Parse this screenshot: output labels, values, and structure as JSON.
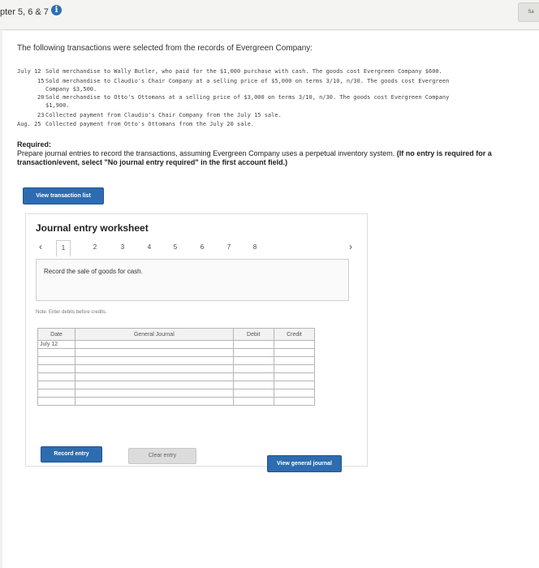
{
  "header": {
    "chapter_title": "pter 5, 6 & 7",
    "info_glyph": "i",
    "save_label": "Sa"
  },
  "problem": {
    "intro": "The following transactions were selected from the records of Evergreen Company:",
    "transactions": [
      {
        "date": "July 12",
        "lines": [
          "Sold merchandise to Wally Butler, who paid for the $1,000 purchase with cash. The goods cost Evergreen Company $600."
        ]
      },
      {
        "date": "15",
        "lines": [
          "Sold merchandise to Claudio's Chair Company at a selling price of $5,000 on terms 3/10, n/30. The goods cost Evergreen",
          "Company $3,500."
        ]
      },
      {
        "date": "20",
        "lines": [
          "Sold merchandise to Otto's Ottomans at a selling price of $3,000 on terms 3/10, n/30. The goods cost Evergreen Company",
          "$1,900."
        ]
      },
      {
        "date": "23",
        "lines": [
          "Collected payment from Claudio's Chair Company from the July 15 sale."
        ]
      },
      {
        "date": "Aug. 25",
        "lines": [
          "Collected payment from Otto's Ottomans from the July 20 sale."
        ]
      }
    ],
    "required_label": "Required:",
    "required_text": "Prepare journal entries to record the transactions, assuming Evergreen Company uses a perpetual inventory system.",
    "required_bold": "(If no entry is required for a transaction/event, select \"No journal entry required\" in the first account field.)",
    "view_transaction_label": "View transaction list"
  },
  "worksheet": {
    "title": "Journal entry worksheet",
    "prev_icon": "chevron-left",
    "next_icon": "chevron-right",
    "pages": [
      "1",
      "2",
      "3",
      "4",
      "5",
      "6",
      "7",
      "8"
    ],
    "active_page": 1,
    "description": "Record the sale of goods for cash.",
    "note": "Note: Enter debits before credits.",
    "columns": {
      "date": "Date",
      "account": "General Journal",
      "debit": "Debit",
      "credit": "Credit"
    },
    "rows": [
      {
        "date": "July 12",
        "account": "",
        "debit": "",
        "credit": ""
      },
      {
        "date": "",
        "account": "",
        "debit": "",
        "credit": ""
      },
      {
        "date": "",
        "account": "",
        "debit": "",
        "credit": ""
      },
      {
        "date": "",
        "account": "",
        "debit": "",
        "credit": ""
      },
      {
        "date": "",
        "account": "",
        "debit": "",
        "credit": ""
      },
      {
        "date": "",
        "account": "",
        "debit": "",
        "credit": ""
      },
      {
        "date": "",
        "account": "",
        "debit": "",
        "credit": ""
      },
      {
        "date": "",
        "account": "",
        "debit": "",
        "credit": ""
      }
    ],
    "record_label": "Record entry",
    "clear_label": "Clear entry",
    "view_journal_label": "View general journal"
  },
  "colors": {
    "accent": "#2d6cb0",
    "info": "#2a6fb5"
  }
}
